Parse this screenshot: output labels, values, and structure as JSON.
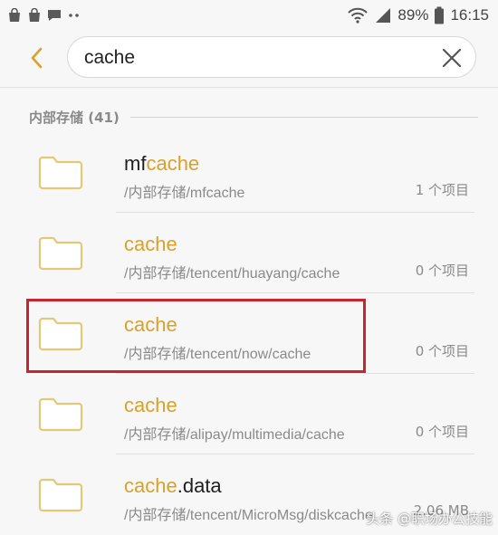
{
  "status_bar": {
    "battery_percent": "89%",
    "time": "16:15",
    "left_icons": [
      "bag-icon",
      "bag-icon",
      "chat-icon",
      "more-dots-icon"
    ],
    "right_icons": [
      "wifi-icon",
      "signal-icon",
      "battery-icon"
    ]
  },
  "search": {
    "query": "cache",
    "placeholder": ""
  },
  "section": {
    "title": "内部存储 (41)"
  },
  "results": [
    {
      "name_prefix": "mf",
      "name_match": "cache",
      "name_suffix": "",
      "path": "/内部存储/mfcache",
      "count": "1 个项目"
    },
    {
      "name_prefix": "",
      "name_match": "cache",
      "name_suffix": "",
      "path": "/内部存储/tencent/huayang/cache",
      "count": "0 个项目"
    },
    {
      "name_prefix": "",
      "name_match": "cache",
      "name_suffix": "",
      "path": "/内部存储/tencent/now/cache",
      "count": "0 个项目"
    },
    {
      "name_prefix": "",
      "name_match": "cache",
      "name_suffix": "",
      "path": "/内部存储/alipay/multimedia/cache",
      "count": "0 个项目"
    },
    {
      "name_prefix": "",
      "name_match": "cache",
      "name_suffix": ".data",
      "path": "/内部存储/tencent/MicroMsg/diskcache",
      "count": "2.06 MB"
    }
  ],
  "colors": {
    "accent": "#d9a128",
    "folder_outline": "#e3c877",
    "highlight_box": "#c8262e",
    "background": "#f7f7f7"
  },
  "watermark": "头条 @职场办公技能"
}
